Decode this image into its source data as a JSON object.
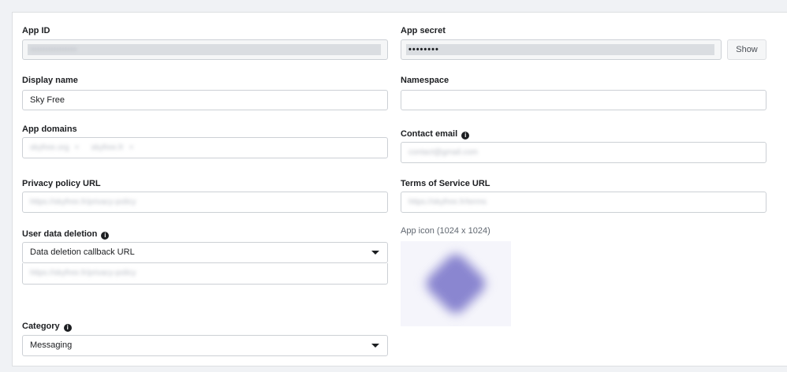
{
  "app_id": {
    "label": "App ID",
    "value": "•••••••••••••••••"
  },
  "app_secret": {
    "label": "App secret",
    "value": "••••••••",
    "show_label": "Show"
  },
  "display_name": {
    "label": "Display name",
    "value": "Sky Free"
  },
  "namespace": {
    "label": "Namespace",
    "value": ""
  },
  "app_domains": {
    "label": "App domains",
    "chips": [
      "skyfree.org",
      "skyfree.fr"
    ]
  },
  "contact_email": {
    "label": "Contact email",
    "value": "contact@gmail.com"
  },
  "privacy_policy_url": {
    "label": "Privacy policy URL",
    "value": "https://skyfree.fr/privacy-policy"
  },
  "terms_url": {
    "label": "Terms of Service URL",
    "value": "https://skyfree.fr/terms"
  },
  "user_data_deletion": {
    "label": "User data deletion",
    "selected": "Data deletion callback URL",
    "url": "https://skyfree.fr/privacy-policy"
  },
  "app_icon": {
    "label": "App icon (1024 x 1024)"
  },
  "category": {
    "label": "Category",
    "selected": "Messaging"
  },
  "colors": {
    "background": "#f0f2f5",
    "card": "#ffffff",
    "border": "#ccd0d5",
    "icon_tint": "#8a86d0"
  }
}
